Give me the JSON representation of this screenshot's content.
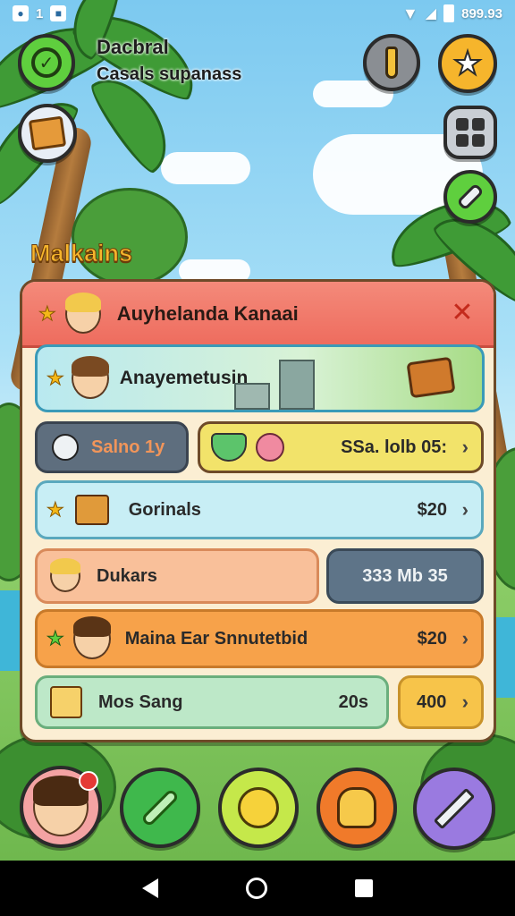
{
  "status_bar": {
    "left_num": "1",
    "time": "899.93"
  },
  "player": {
    "name": "Dacbral",
    "subtitle": "Casals supanass"
  },
  "section_title": "Malkains",
  "panel": {
    "header_title": "Auyhelanda Kanaai",
    "banner_title": "Anayemetusin",
    "rows": [
      {
        "left_label": "Salno 1y",
        "right_price": "SSa. lolb 05:"
      },
      {
        "label": "Gorinals",
        "price": "$20"
      },
      {
        "label": "Dukars",
        "right_label": "333 Mb 35"
      },
      {
        "label": "Maina Ear Snnutetbid",
        "price": "$20"
      },
      {
        "label": "Mos Sang",
        "mid_value": "20s",
        "price": "400"
      }
    ]
  },
  "colors": {
    "header": "#ee6c5e",
    "cyan_row": "#c8eef5",
    "orange_row": "#f7a24a",
    "green_row": "#bde8c8",
    "yellow": "#f2e36a"
  },
  "bottom_buttons": [
    "profile",
    "leaf-sword",
    "chick",
    "character",
    "pencil"
  ]
}
